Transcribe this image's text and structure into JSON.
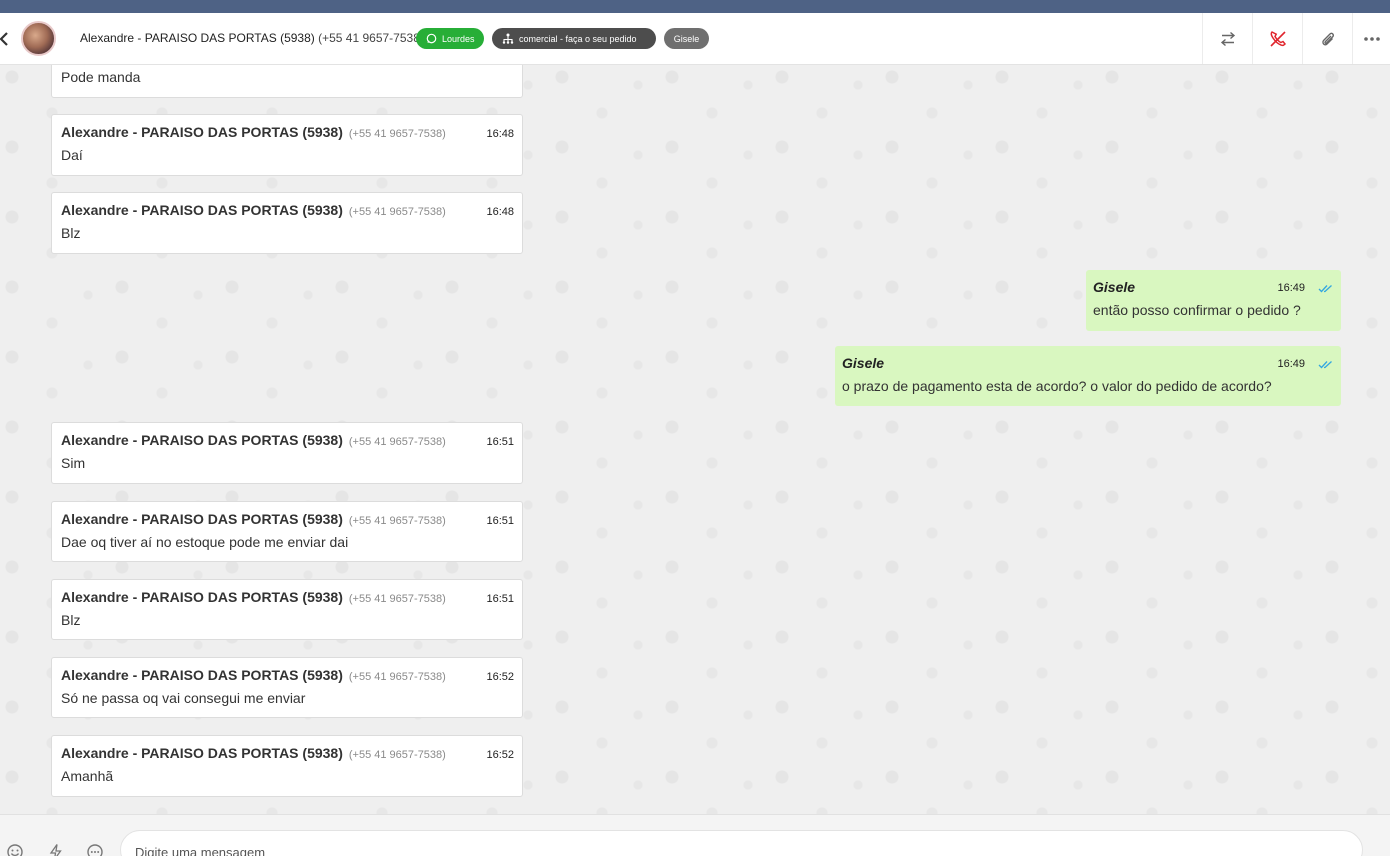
{
  "header": {
    "contact_name": "Alexandre - PARAISO DAS PORTAS (5938)",
    "contact_phone": "(+55 41 9657-7538)",
    "badges": {
      "channel": "Lourdes",
      "department": "comercial - faça o seu pedido",
      "agent": "Gisele"
    },
    "colors": {
      "channel": "#27ae37",
      "department": "#4d4d4d",
      "agent": "#6f6f6f",
      "topbar": "#4e6285"
    }
  },
  "messages": [
    {
      "dir": "in",
      "text": "Pode manda"
    },
    {
      "dir": "in",
      "sender": "Alexandre - PARAISO DAS PORTAS (5938)",
      "phone": "(+55 41 9657-7538)",
      "time": "16:48",
      "text": "Daí"
    },
    {
      "dir": "in",
      "sender": "Alexandre - PARAISO DAS PORTAS (5938)",
      "phone": "(+55 41 9657-7538)",
      "time": "16:48",
      "text": "Blz"
    },
    {
      "dir": "out",
      "sender": "Gisele",
      "time": "16:49",
      "text": "então posso confirmar o pedido ?"
    },
    {
      "dir": "out",
      "sender": "Gisele",
      "time": "16:49",
      "text": "o prazo de pagamento esta de acordo? o valor do pedido de acordo?"
    },
    {
      "dir": "in",
      "sender": "Alexandre - PARAISO DAS PORTAS (5938)",
      "phone": "(+55 41 9657-7538)",
      "time": "16:51",
      "text": "Sim"
    },
    {
      "dir": "in",
      "sender": "Alexandre - PARAISO DAS PORTAS (5938)",
      "phone": "(+55 41 9657-7538)",
      "time": "16:51",
      "text": "Dae oq tiver aí no estoque pode me enviar dai"
    },
    {
      "dir": "in",
      "sender": "Alexandre - PARAISO DAS PORTAS (5938)",
      "phone": "(+55 41 9657-7538)",
      "time": "16:51",
      "text": "Blz"
    },
    {
      "dir": "in",
      "sender": "Alexandre - PARAISO DAS PORTAS (5938)",
      "phone": "(+55 41 9657-7538)",
      "time": "16:52",
      "text": "Só ne passa oq vai consegui me enviar"
    },
    {
      "dir": "in",
      "sender": "Alexandre - PARAISO DAS PORTAS (5938)",
      "phone": "(+55 41 9657-7538)",
      "time": "16:52",
      "text": "Amanhã"
    }
  ],
  "composer": {
    "placeholder": "Digite uma mensagem"
  },
  "icons": {
    "header": [
      "back-icon",
      "whatsapp-icon",
      "department-icon",
      "transfer-icon",
      "end-call-icon",
      "attachment-icon",
      "more-icon"
    ],
    "footer": [
      "emoji-icon",
      "quick-reply-icon",
      "options-icon"
    ]
  }
}
